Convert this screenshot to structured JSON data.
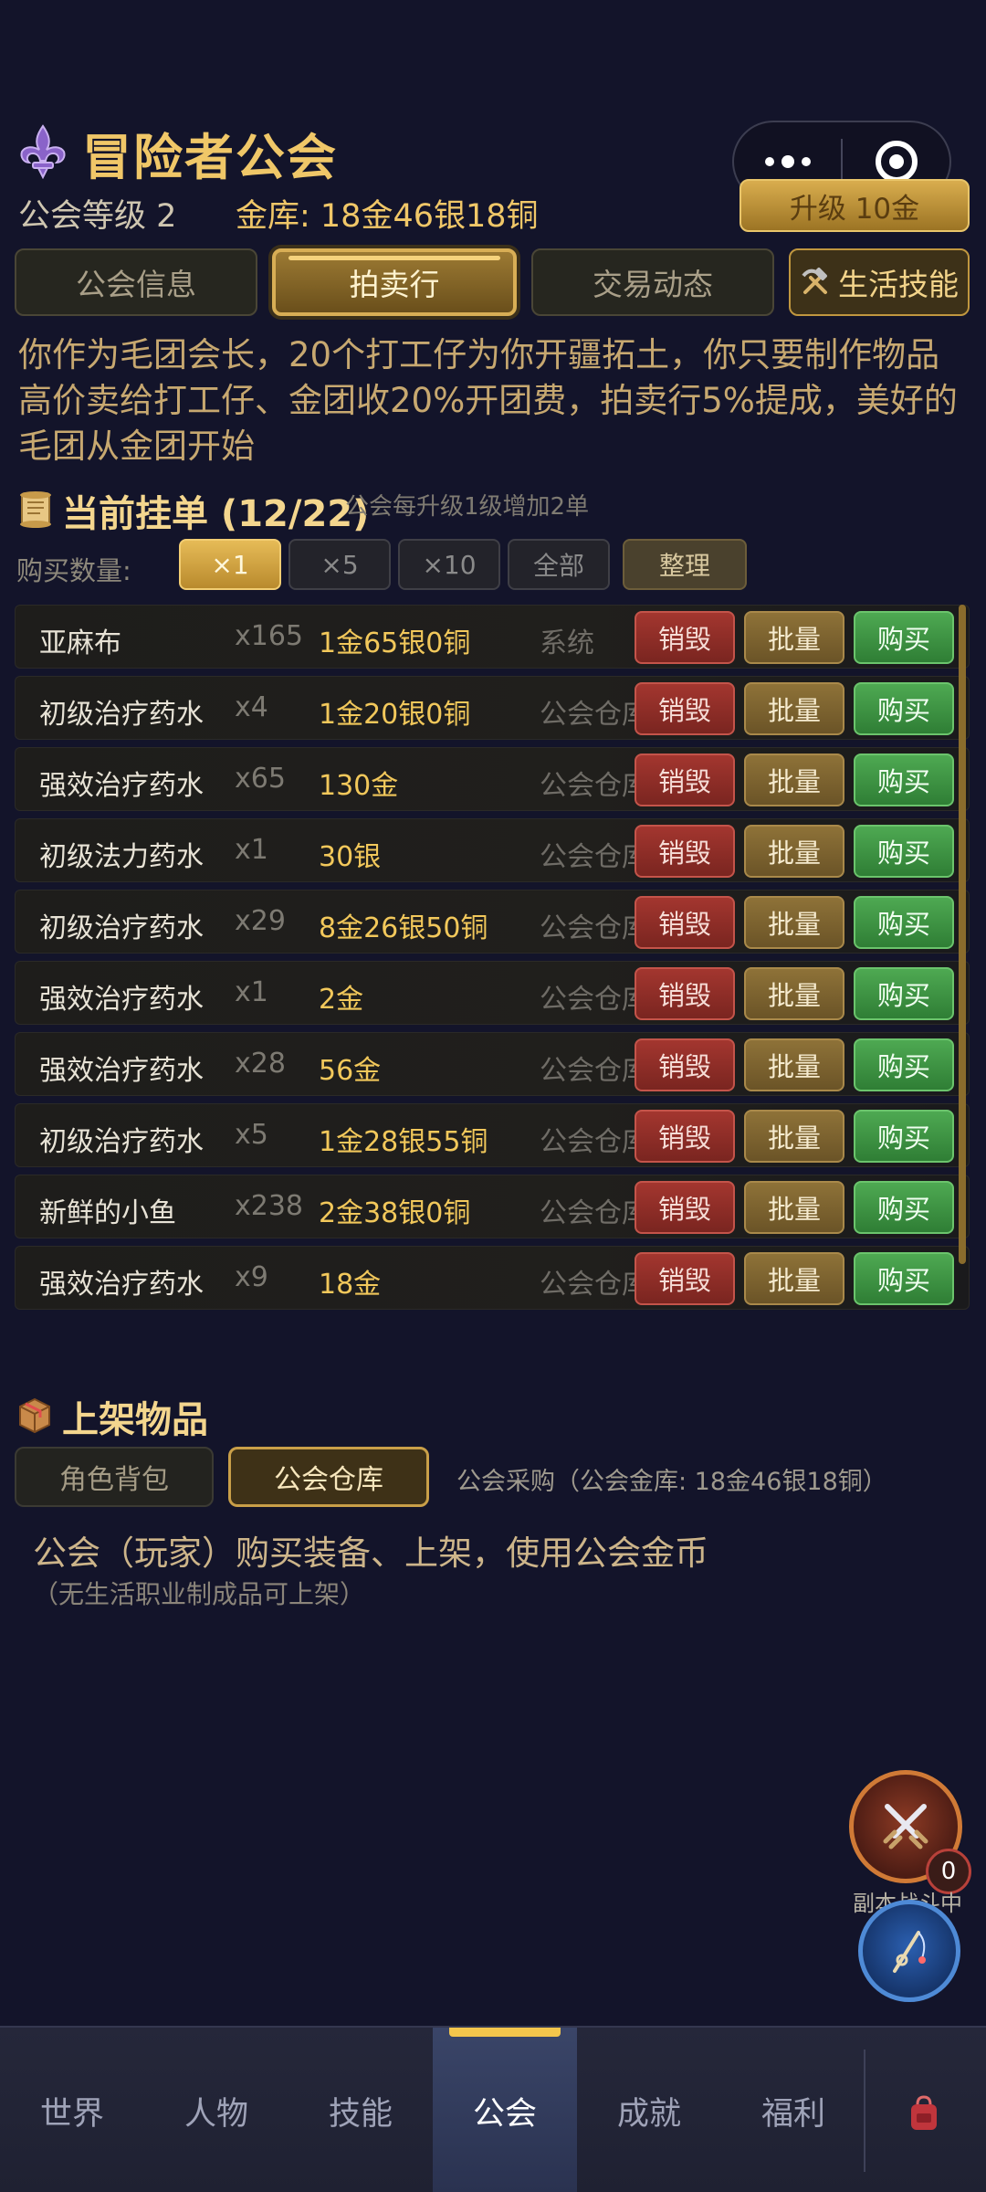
{
  "header": {
    "title": "冒险者公会",
    "level": "公会等级 2",
    "treasury": "金库: 18金46银18铜",
    "upgrade": "升级 10金"
  },
  "tabs": [
    {
      "label": "公会信息"
    },
    {
      "label": "拍卖行"
    },
    {
      "label": "交易动态"
    },
    {
      "label": "生活技能"
    }
  ],
  "description": "你作为毛团会长，20个打工仔为你开疆拓土，你只要制作物品高价卖给打工仔、金团收20%开团费，拍卖行5%提成，美好的毛团从金团开始",
  "listings": {
    "title": "当前挂单 (12/22)",
    "note": "公会每升级1级增加2单",
    "qty_label": "购买数量:",
    "qty_options": [
      "×1",
      "×5",
      "×10",
      "全部"
    ],
    "sort_label": "整理",
    "btn_destroy": "销毁",
    "btn_bulk": "批量",
    "btn_buy": "购买",
    "rows": [
      {
        "name": "亚麻布",
        "count": "x165",
        "price": "1金65银0铜",
        "seller": "系统"
      },
      {
        "name": "初级治疗药水",
        "count": "x4",
        "price": "1金20银0铜",
        "seller": "公会仓库"
      },
      {
        "name": "强效治疗药水",
        "count": "x65",
        "price": "130金",
        "seller": "公会仓库"
      },
      {
        "name": "初级法力药水",
        "count": "x1",
        "price": "30银",
        "seller": "公会仓库"
      },
      {
        "name": "初级治疗药水",
        "count": "x29",
        "price": "8金26银50铜",
        "seller": "公会仓库"
      },
      {
        "name": "强效治疗药水",
        "count": "x1",
        "price": "2金",
        "seller": "公会仓库"
      },
      {
        "name": "强效治疗药水",
        "count": "x28",
        "price": "56金",
        "seller": "公会仓库"
      },
      {
        "name": "初级治疗药水",
        "count": "x5",
        "price": "1金28银55铜",
        "seller": "公会仓库"
      },
      {
        "name": "新鲜的小鱼",
        "count": "x238",
        "price": "2金38银0铜",
        "seller": "公会仓库"
      },
      {
        "name": "强效治疗药水",
        "count": "x9",
        "price": "18金",
        "seller": "公会仓库"
      }
    ]
  },
  "shelve": {
    "title": "上架物品",
    "tabs": [
      "角色背包",
      "公会仓库"
    ],
    "purchase_note": "公会采购（公会金库: 18金46银18铜）",
    "hint_main": "公会（玩家）购买装备、上架，使用公会金币",
    "hint_sub": "（无生活职业制成品可上架）"
  },
  "float": {
    "battle_badge": "0",
    "battle_label": "副本战斗中"
  },
  "nav": {
    "items": [
      "世界",
      "人物",
      "技能",
      "公会",
      "成就",
      "福利"
    ],
    "active": "公会"
  },
  "colors": {
    "accent_gold": "#f0c768",
    "destroy": "#a3362f",
    "bulk": "#8e7238",
    "buy": "#4ea952",
    "background": "#13142a"
  },
  "icons": [
    "fleur-de-lis-icon",
    "scroll-icon",
    "box-icon",
    "hammer-pick-icon",
    "crossed-swords-icon",
    "fishing-icon",
    "backpack-icon"
  ]
}
